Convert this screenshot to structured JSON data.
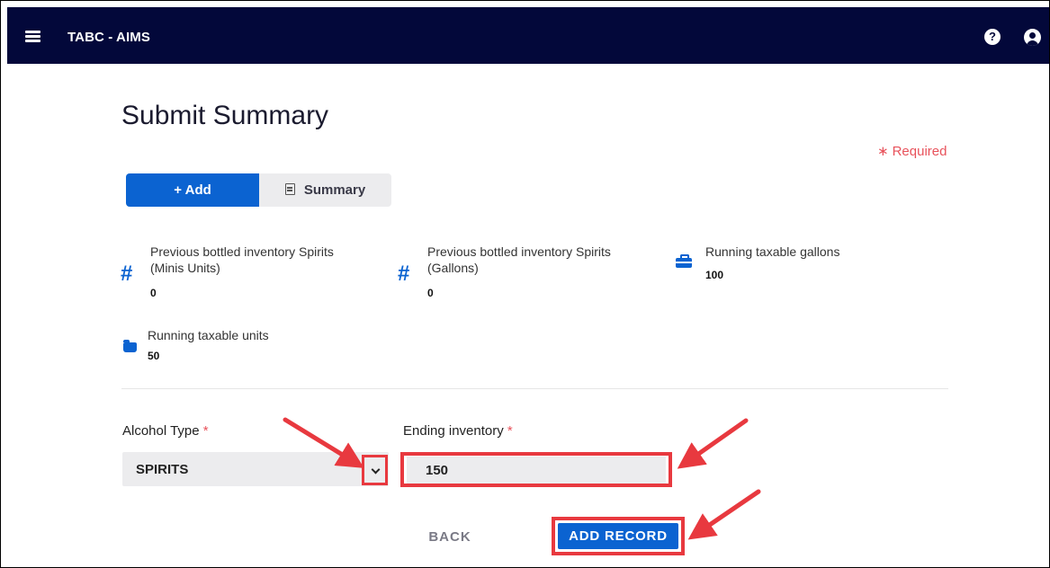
{
  "header": {
    "app_title": "TABC - AIMS",
    "menu_icon": "hamburger-menu-icon",
    "help_icon": "question-circle-icon",
    "help_glyph": "?",
    "user_icon": "user-circle-icon",
    "background_color": "#03083a"
  },
  "page": {
    "title": "Submit Summary",
    "required_star": "∗",
    "required_text": "Required"
  },
  "tabs": {
    "add_label": "+ Add",
    "summary_label": "Summary",
    "summary_icon": "document-icon",
    "active": "Add"
  },
  "stats": [
    {
      "icon": "hash-icon",
      "glyph": "#",
      "label_line1": "Previous bottled inventory Spirits",
      "label_line2": "(Minis Units)",
      "value": "0"
    },
    {
      "icon": "hash-icon",
      "glyph": "#",
      "label_line1": "Previous bottled inventory Spirits",
      "label_line2": "(Gallons)",
      "value": "0"
    },
    {
      "icon": "briefcase-icon",
      "label_line1": "Running taxable gallons",
      "value": "100"
    },
    {
      "icon": "folder-icon",
      "label_line1": "Running taxable units",
      "value": "50"
    }
  ],
  "form": {
    "alcohol_type_label": "Alcohol Type",
    "alcohol_type_value": "SPIRITS",
    "ending_inventory_label": "Ending inventory",
    "ending_inventory_value": "150",
    "required_marker": "*"
  },
  "actions": {
    "back_label": "BACK",
    "add_record_label": "ADD RECORD"
  },
  "colors": {
    "primary": "#0b63d1",
    "annotation_red": "#e8393f",
    "required_red": "#e8525b"
  }
}
